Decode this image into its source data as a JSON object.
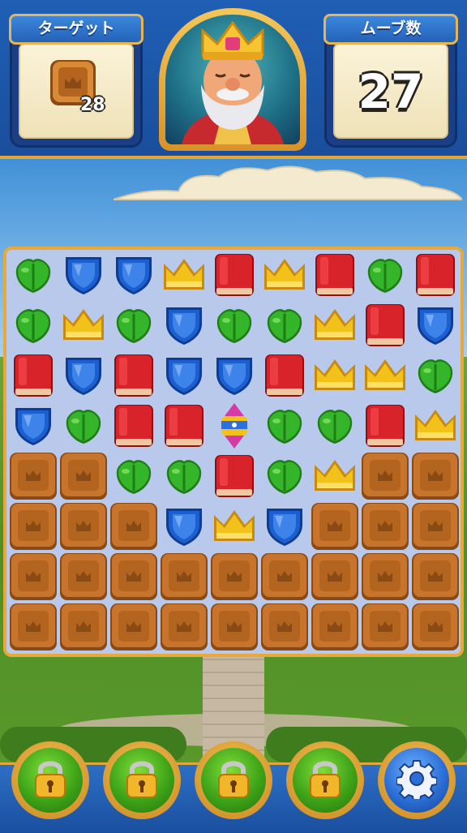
{
  "hud": {
    "target_label": "ターゲット",
    "target_count": "28",
    "target_icon": "wooden-crate-icon",
    "moves_label": "ムーブ数",
    "moves_count": "27",
    "character": "king-portrait"
  },
  "board": {
    "columns": 9,
    "rows": 8,
    "legend": {
      "L": "green-leaf",
      "S": "blue-shield",
      "C": "yellow-crown",
      "R": "red-book",
      "W": "wooden-crate",
      "P": "propeller-powerup"
    },
    "cells": [
      [
        "L",
        "S",
        "S",
        "C",
        "R",
        "C",
        "R",
        "L",
        "R"
      ],
      [
        "L",
        "C",
        "L",
        "S",
        "L",
        "L",
        "C",
        "R",
        "S"
      ],
      [
        "R",
        "S",
        "R",
        "S",
        "S",
        "R",
        "C",
        "C",
        "L"
      ],
      [
        "S",
        "L",
        "R",
        "R",
        "P",
        "L",
        "L",
        "R",
        "C"
      ],
      [
        "W",
        "W",
        "L",
        "L",
        "R",
        "L",
        "C",
        "W",
        "W"
      ],
      [
        "W",
        "W",
        "W",
        "S",
        "C",
        "S",
        "W",
        "W",
        "W"
      ],
      [
        "W",
        "W",
        "W",
        "W",
        "W",
        "W",
        "W",
        "W",
        "W"
      ],
      [
        "W",
        "W",
        "W",
        "W",
        "W",
        "W",
        "W",
        "W",
        "W"
      ]
    ]
  },
  "boosters": [
    {
      "name": "booster-slot-1",
      "icon": "padlock-icon",
      "locked": true
    },
    {
      "name": "booster-slot-2",
      "icon": "padlock-icon",
      "locked": true
    },
    {
      "name": "booster-slot-3",
      "icon": "padlock-icon",
      "locked": true
    },
    {
      "name": "booster-slot-4",
      "icon": "padlock-icon",
      "locked": true
    },
    {
      "name": "settings-button",
      "icon": "gear-icon",
      "locked": false
    }
  ],
  "colors": {
    "hud_blue": "#1f5fb5",
    "gold_trim": "#e3a63a",
    "leaf_green": "#35b52a",
    "shield_blue": "#1b5fd1",
    "crown_yellow": "#f2c21a",
    "book_red": "#d8232a",
    "crate_brown": "#c9742c"
  }
}
